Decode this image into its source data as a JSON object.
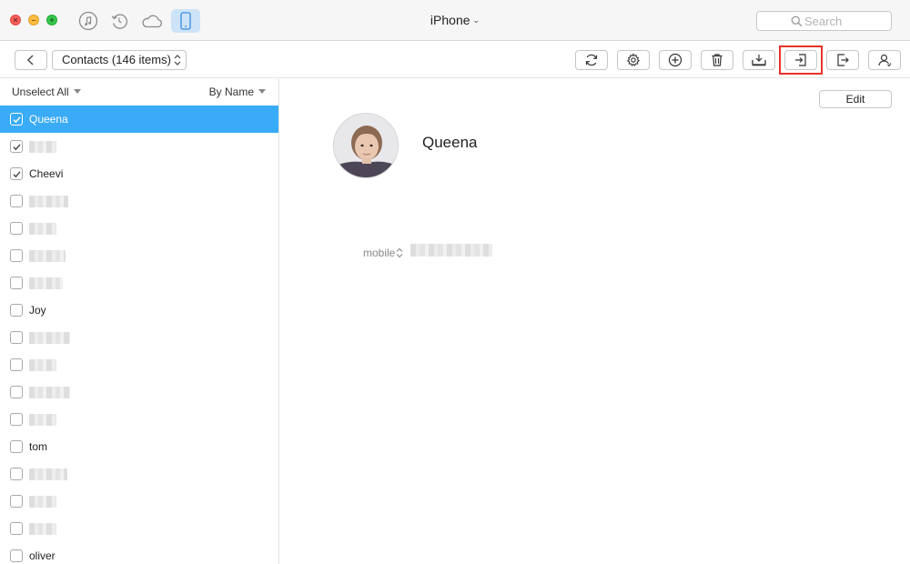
{
  "window": {
    "device_title": "iPhone",
    "search_placeholder": "Search"
  },
  "nav_icons": [
    "music-note-icon",
    "restore-history-icon",
    "cloud-icon",
    "phone-icon"
  ],
  "toolbar": {
    "category_label": "Contacts (146 items)",
    "buttons": [
      "refresh-icon",
      "settings-gear-icon",
      "add-icon",
      "trash-icon",
      "to-computer-icon",
      "import-icon",
      "export-icon",
      "contact-card-icon"
    ],
    "highlighted_button": "import-icon"
  },
  "list": {
    "unselect_all_label": "Unselect All",
    "sort_label": "By Name",
    "rows": [
      {
        "name": "Queena",
        "checked": true,
        "selected": true
      },
      {
        "name": "",
        "checked": true,
        "selected": false
      },
      {
        "name": "Cheevi",
        "checked": true,
        "selected": false
      },
      {
        "name": "",
        "checked": false,
        "selected": false
      },
      {
        "name": "",
        "checked": false,
        "selected": false
      },
      {
        "name": "",
        "checked": false,
        "selected": false
      },
      {
        "name": "",
        "checked": false,
        "selected": false
      },
      {
        "name": "Joy",
        "checked": false,
        "selected": false
      },
      {
        "name": "",
        "checked": false,
        "selected": false
      },
      {
        "name": "",
        "checked": false,
        "selected": false
      },
      {
        "name": "",
        "checked": false,
        "selected": false
      },
      {
        "name": "",
        "checked": false,
        "selected": false
      },
      {
        "name": "tom",
        "checked": false,
        "selected": false
      },
      {
        "name": "",
        "checked": false,
        "selected": false
      },
      {
        "name": "",
        "checked": false,
        "selected": false
      },
      {
        "name": "",
        "checked": false,
        "selected": false
      },
      {
        "name": "oliver",
        "checked": false,
        "selected": false
      }
    ]
  },
  "detail": {
    "edit_label": "Edit",
    "contact_name": "Queena",
    "phone_label": "mobile"
  },
  "colors": {
    "selection_blue": "#3aabf7",
    "highlight_red": "#e8332a",
    "active_nav_bg": "#cde3f8"
  }
}
